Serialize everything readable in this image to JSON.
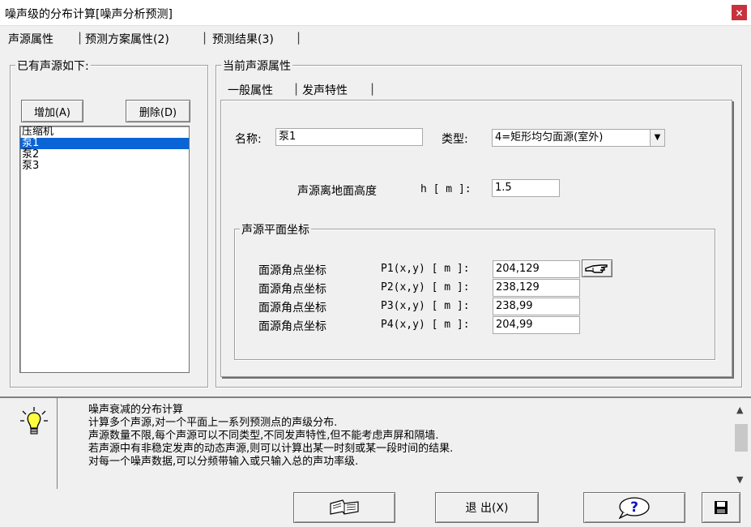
{
  "window": {
    "title": "噪声级的分布计算[噪声分析预测]",
    "close_glyph": "×"
  },
  "main_tabs": [
    {
      "label": "声源属性"
    },
    {
      "label": "预测方案属性(2)"
    },
    {
      "label": "预测结果(3)"
    }
  ],
  "left_panel": {
    "title": "已有声源如下:",
    "add_button": "增加(A)",
    "delete_button": "删除(D)",
    "sources": [
      "压缩机",
      "泵1",
      "泵2",
      "泵3"
    ],
    "selected_index": 1
  },
  "right_panel": {
    "title": "当前声源属性",
    "tabs": [
      {
        "label": "一般属性"
      },
      {
        "label": "发声特性"
      }
    ],
    "name_label": "名称:",
    "name_value": "泵1",
    "type_label": "类型:",
    "type_value": "4=矩形均匀面源(室外)",
    "height_label": "声源离地面高度",
    "height_symbol": "h [ m ]:",
    "height_value": "1.5",
    "coords_group_title": "声源平面坐标",
    "corners": [
      {
        "label": "面源角点坐标",
        "point": "P1(x,y) [ m ]:",
        "value": "204,129"
      },
      {
        "label": "面源角点坐标",
        "point": "P2(x,y) [ m ]:",
        "value": "238,129"
      },
      {
        "label": "面源角点坐标",
        "point": "P3(x,y) [ m ]:",
        "value": "238,99"
      },
      {
        "label": "面源角点坐标",
        "point": "P4(x,y) [ m ]:",
        "value": "204,99"
      }
    ],
    "pick_icon": "hand-pointer-icon"
  },
  "help": {
    "icon": "lightbulb-icon",
    "lines": [
      "噪声衰减的分布计算",
      "计算多个声源,对一个平面上一系列预测点的声级分布.",
      "声源数量不限,每个声源可以不同类型,不同发声特性,但不能考虑声屏和隔墙.",
      "若声源中有非稳定发声的动态声源,则可以计算出某一时刻或某一段时间的结果.",
      "对每一个噪声数据,可以分频带输入或只输入总的声功率级."
    ]
  },
  "bottom": {
    "book_icon": "open-book-icon",
    "exit_button": "退 出(X)",
    "help_icon": "question-icon",
    "save_icon": "floppy-disk-icon"
  }
}
